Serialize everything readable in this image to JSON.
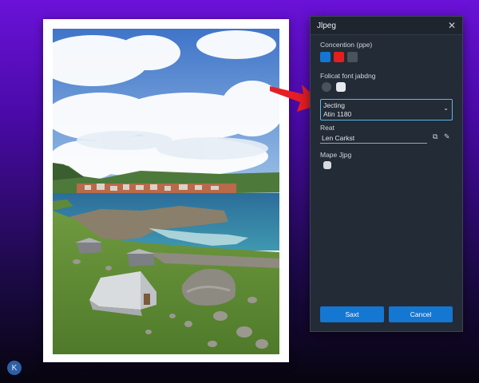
{
  "dialog": {
    "title": "Jlpeg",
    "close_glyph": "✕",
    "section1_label": "Concention (ppe)",
    "section1_swatches": [
      "#1476d3",
      "#e41e1e",
      "#4a525c"
    ],
    "section2_label": "Folicat font jabdng",
    "section3_select_line1": "Jecting",
    "section3_select_line2": "Atin 1180",
    "section4_label": "Reat",
    "section4_input_value": "Len Carkst",
    "section5_label": "Mape Jjpg",
    "save_button": "Saxt",
    "cancel_button": "Cancel",
    "accent_color": "#1477d2",
    "focus_color": "#5bb7e4"
  },
  "corner_icon_glyph": "K"
}
